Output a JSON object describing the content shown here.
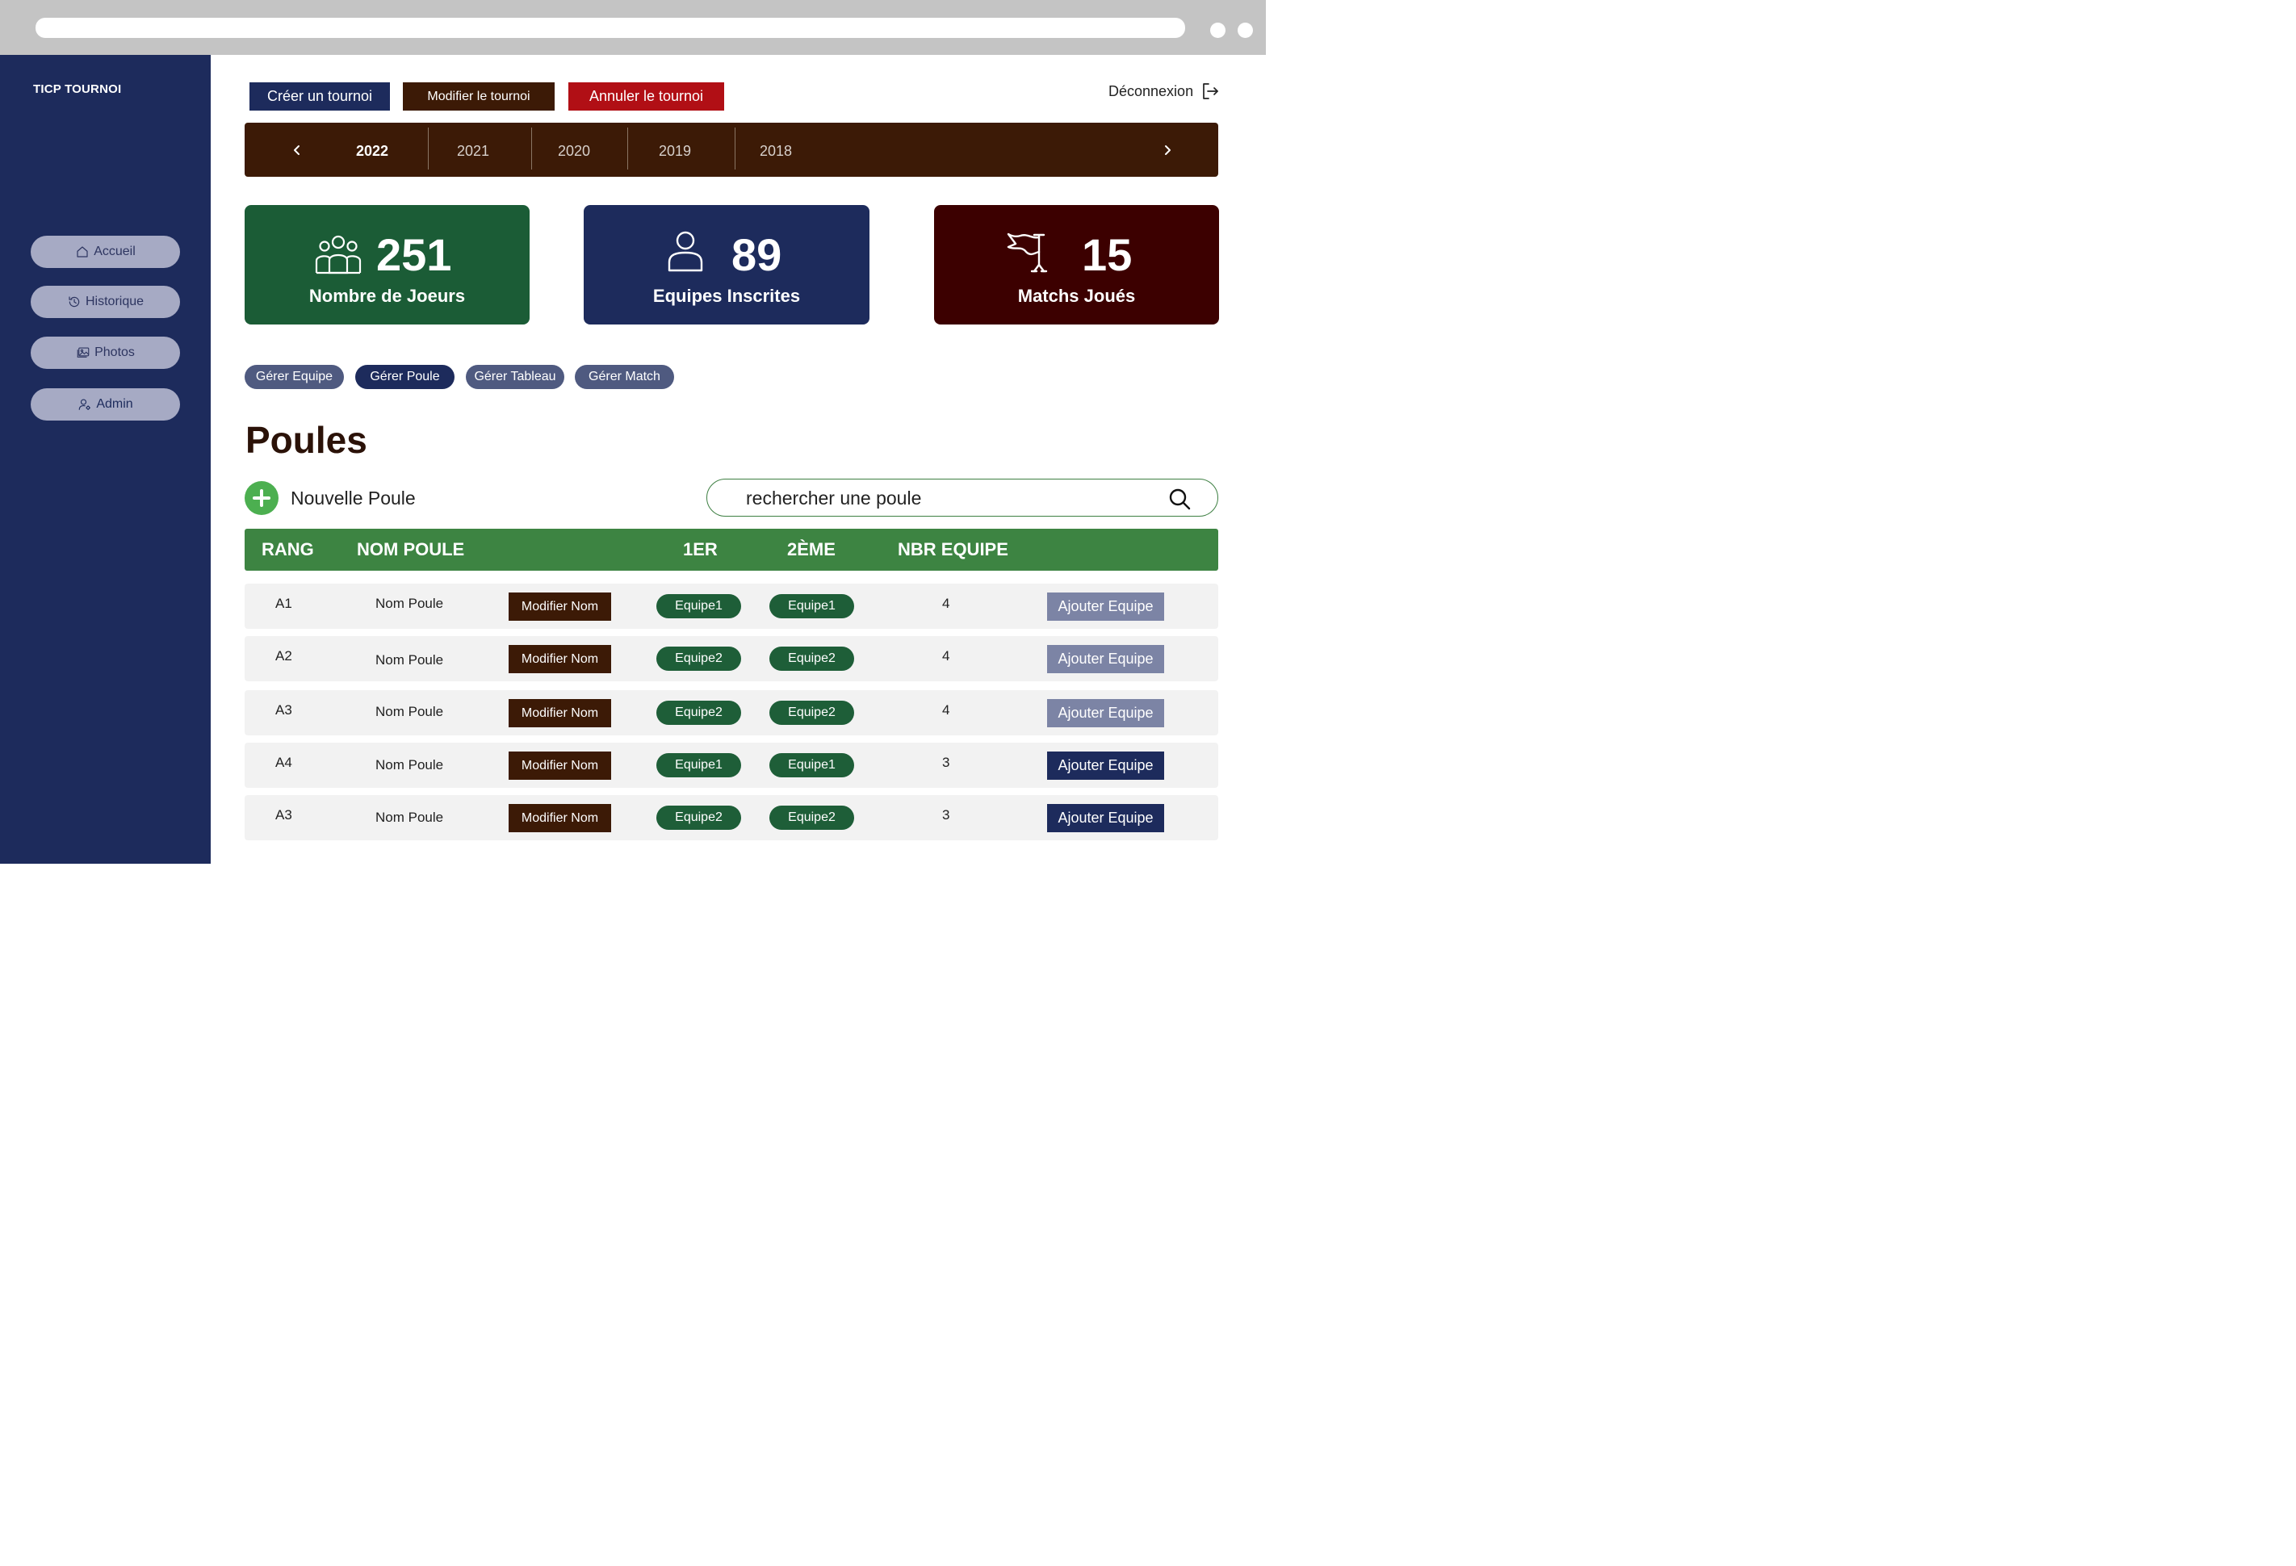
{
  "app": {
    "brand": "TICP TOURNOI"
  },
  "sidebar": {
    "items": [
      {
        "label": "Accueil",
        "icon": "home-icon"
      },
      {
        "label": "Historique",
        "icon": "history-icon"
      },
      {
        "label": "Photos",
        "icon": "photos-icon"
      },
      {
        "label": "Admin",
        "icon": "admin-icon"
      }
    ]
  },
  "actions": {
    "create": "Créer un tournoi",
    "edit": "Modifier le tournoi",
    "cancel": "Annuler le tournoi",
    "logout": "Déconnexion"
  },
  "years": {
    "active": "2022",
    "items": [
      "2022",
      "2021",
      "2020",
      "2019",
      "2018"
    ]
  },
  "stats": [
    {
      "value": "251",
      "label": "Nombre de Joeurs",
      "icon": "players-icon"
    },
    {
      "value": "89",
      "label": "Equipes Inscrites",
      "icon": "user-icon"
    },
    {
      "value": "15",
      "label": "Matchs Joués",
      "icon": "flag-icon"
    }
  ],
  "tabs": [
    {
      "label": "Gérer Equipe",
      "active": false
    },
    {
      "label": "Gérer Poule",
      "active": true
    },
    {
      "label": "Gérer Tableau",
      "active": false
    },
    {
      "label": "Gérer Match",
      "active": false
    }
  ],
  "page": {
    "title": "Poules",
    "new_label": "Nouvelle Poule",
    "search_placeholder": "rechercher une poule"
  },
  "table": {
    "headers": {
      "rank": "RANG",
      "name": "NOM POULE",
      "first": "1ER",
      "second": "2ÈME",
      "count": "NBR EQUIPE"
    },
    "edit_label": "Modifier Nom",
    "add_label": "Ajouter Equipe",
    "rows": [
      {
        "rank": "A1",
        "name": "Nom Poule",
        "first": "Equipe1",
        "second": "Equipe1",
        "count": "4"
      },
      {
        "rank": "A2",
        "name": "Nom Poule",
        "first": "Equipe2",
        "second": "Equipe2",
        "count": "4"
      },
      {
        "rank": "A3",
        "name": "Nom Poule",
        "first": "Equipe2",
        "second": "Equipe2",
        "count": "4"
      },
      {
        "rank": "A4",
        "name": "Nom Poule",
        "first": "Equipe1",
        "second": "Equipe1",
        "count": "3"
      },
      {
        "rank": "A3",
        "name": "Nom Poule",
        "first": "Equipe2",
        "second": "Equipe2",
        "count": "3"
      }
    ]
  },
  "colors": {
    "sidebar": "#1d2b5c",
    "brown": "#3c1a06",
    "danger": "#b10f15",
    "green_card": "#1b5c36",
    "red_card": "#3c0000",
    "table_header": "#3d8442",
    "team_pill": "#1e5e38"
  }
}
